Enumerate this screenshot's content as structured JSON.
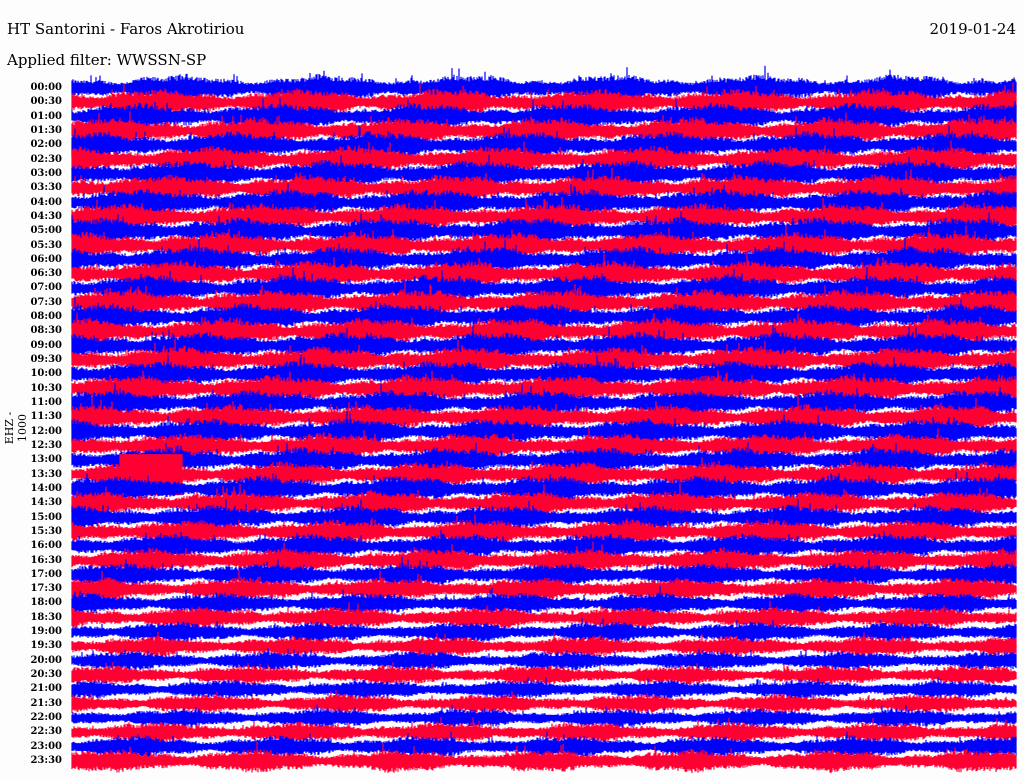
{
  "header": {
    "title": "HT Santorini - Faros Akrotiriou",
    "date": "2019-01-24",
    "filter": "Applied filter: WWSSN-SP"
  },
  "chart_data": {
    "type": "line",
    "title": "HT Santorini - Faros Akrotiriou",
    "subtitle": "Applied filter: WWSSN-SP",
    "ylabel": "EHZ - 1000",
    "colors": [
      "#0000ff",
      "#ff0033"
    ],
    "rows": [
      "00:00",
      "00:30",
      "01:00",
      "01:30",
      "02:00",
      "02:30",
      "03:00",
      "03:30",
      "04:00",
      "04:30",
      "05:00",
      "05:30",
      "06:00",
      "06:30",
      "07:00",
      "07:30",
      "08:00",
      "08:30",
      "09:00",
      "09:30",
      "10:00",
      "10:30",
      "11:00",
      "11:30",
      "12:00",
      "12:30",
      "13:00",
      "13:30",
      "14:00",
      "14:30",
      "15:00",
      "15:30",
      "16:00",
      "16:30",
      "17:00",
      "17:30",
      "18:00",
      "18:30",
      "19:00",
      "19:30",
      "20:00",
      "20:30",
      "21:00",
      "21:30",
      "22:00",
      "22:30",
      "23:00",
      "23:30"
    ],
    "relative_amplitude": [
      1.0,
      1.0,
      1.0,
      1.0,
      1.0,
      1.0,
      1.0,
      1.0,
      1.0,
      1.0,
      1.0,
      1.0,
      1.0,
      1.0,
      1.0,
      1.0,
      1.0,
      1.0,
      1.0,
      1.0,
      1.0,
      1.0,
      0.95,
      0.95,
      0.95,
      0.95,
      0.95,
      0.95,
      0.95,
      0.9,
      0.9,
      0.9,
      0.9,
      0.9,
      0.85,
      0.85,
      0.8,
      0.8,
      0.75,
      0.75,
      0.7,
      0.7,
      0.7,
      0.7,
      0.7,
      0.75,
      0.8,
      0.85
    ],
    "events": [
      {
        "row": "13:30",
        "minute_start": 1.5,
        "minute_end": 3.5
      }
    ]
  }
}
